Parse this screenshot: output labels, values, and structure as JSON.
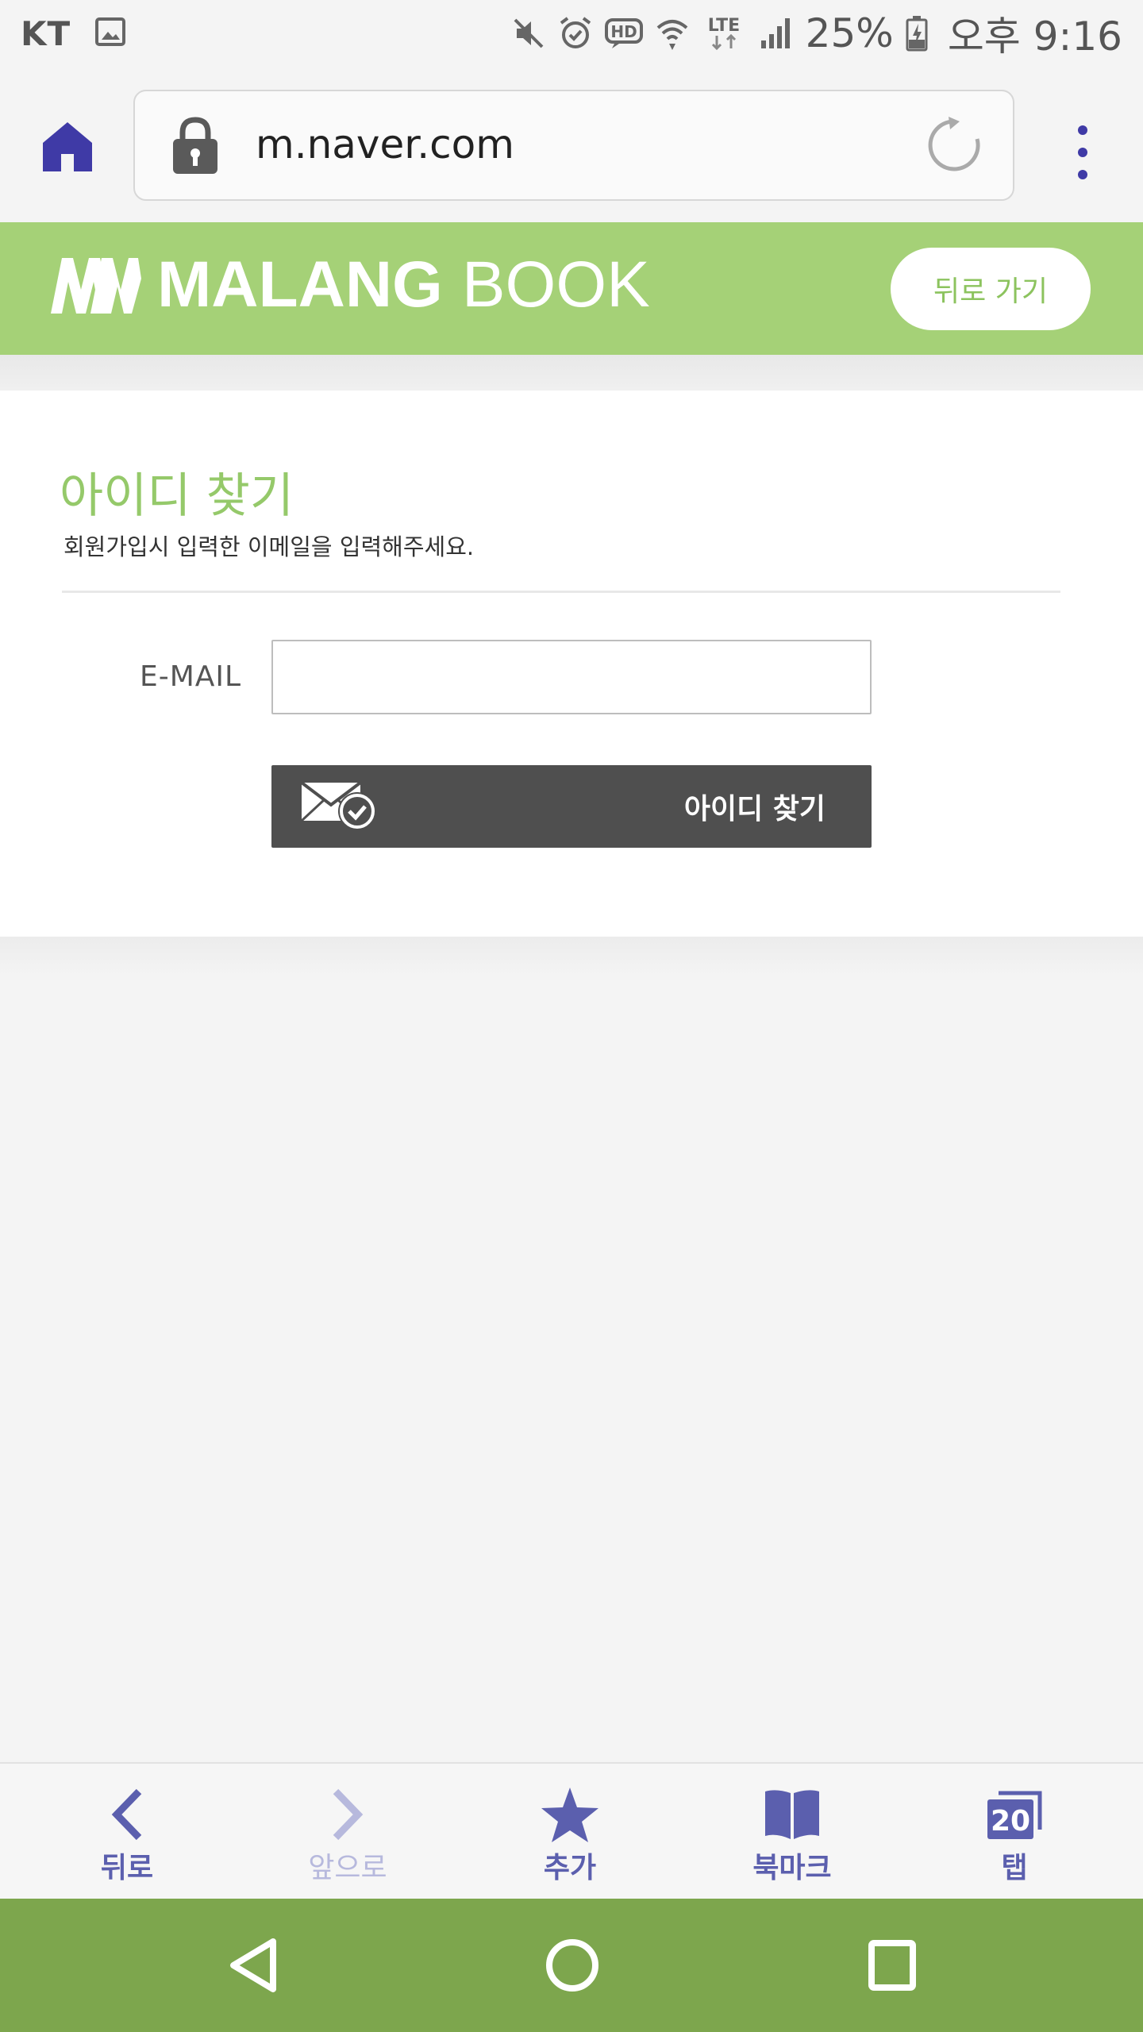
{
  "status_bar": {
    "carrier": "KT",
    "battery_percent": "25%",
    "time": "오후 9:16",
    "network_label": "LTE",
    "hd_label": "HD"
  },
  "browser": {
    "url": "m.naver.com",
    "accent_color": "#3f3aa6"
  },
  "site_header": {
    "brand_bold": "MALANG",
    "brand_light": "BOOK",
    "back_button_label": "뒤로 가기",
    "brand_color": "#a5d177"
  },
  "find_id": {
    "title": "아이디 찾기",
    "description": "회원가입시 입력한 이메일을 입력해주세요.",
    "email_label": "E-MAIL",
    "email_value": "",
    "submit_label": "아이디 찾기",
    "button_icon": "mail-check-icon"
  },
  "bottom_nav": {
    "items": [
      {
        "label": "뒤로",
        "icon": "chevron-left-icon",
        "enabled": true
      },
      {
        "label": "앞으로",
        "icon": "chevron-right-icon",
        "enabled": false
      },
      {
        "label": "추가",
        "icon": "star-icon",
        "enabled": true
      },
      {
        "label": "북마크",
        "icon": "book-icon",
        "enabled": true
      },
      {
        "label": "탭",
        "icon": "tabs-icon",
        "enabled": true,
        "count": "20"
      }
    ]
  },
  "system_nav": {
    "color": "#7da64d",
    "buttons": [
      "back-triangle-icon",
      "home-circle-icon",
      "recents-square-icon"
    ]
  }
}
